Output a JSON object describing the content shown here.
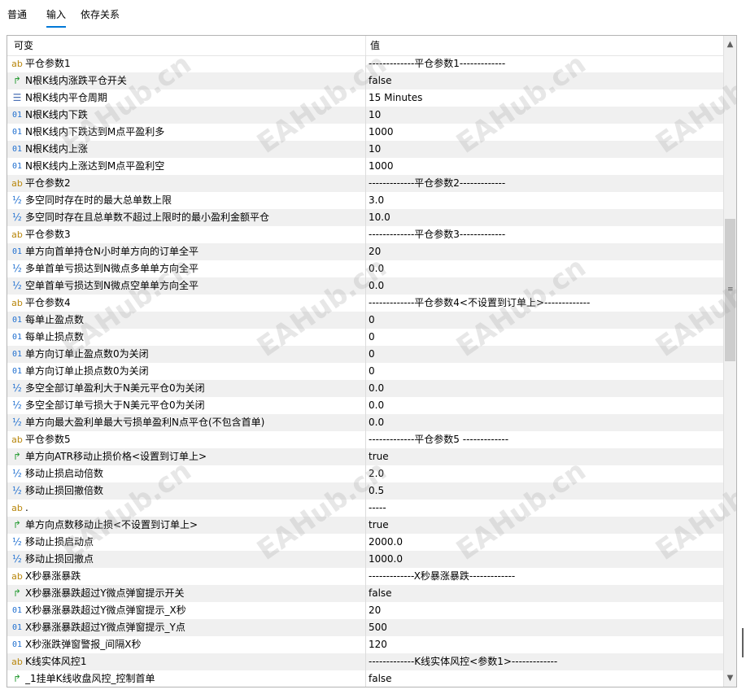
{
  "tabs": [
    {
      "label": "普通"
    },
    {
      "label": "输入"
    },
    {
      "label": "依存关系"
    }
  ],
  "active_tab": "输入",
  "table": {
    "header": {
      "name": "可变",
      "value": "值"
    },
    "rows": [
      {
        "icon": "ab",
        "name": "平仓参数1",
        "value": "-------------平仓参数1-------------"
      },
      {
        "icon": "bool",
        "name": "N根K线内涨跌平仓开关",
        "value": "false"
      },
      {
        "icon": "enum",
        "name": "N根K线内平仓周期",
        "value": "15 Minutes"
      },
      {
        "icon": "01",
        "name": "N根K线内下跌",
        "value": "10"
      },
      {
        "icon": "01",
        "name": "N根K线内下跌达到M点平盈利多",
        "value": "1000"
      },
      {
        "icon": "01",
        "name": "N根K线内上涨",
        "value": "10"
      },
      {
        "icon": "01",
        "name": "N根K线内上涨达到M点平盈利空",
        "value": "1000"
      },
      {
        "icon": "ab",
        "name": "平仓参数2",
        "value": "-------------平仓参数2-------------"
      },
      {
        "icon": "half",
        "name": "多空同时存在时的最大总单数上限",
        "value": "3.0"
      },
      {
        "icon": "half",
        "name": "多空同时存在且总单数不超过上限时的最小盈利金额平仓",
        "value": "10.0"
      },
      {
        "icon": "ab",
        "name": "平仓参数3",
        "value": "-------------平仓参数3-------------"
      },
      {
        "icon": "01",
        "name": "单方向首单持仓N小时单方向的订单全平",
        "value": "20"
      },
      {
        "icon": "half",
        "name": "多单首单亏损达到N微点多单单方向全平",
        "value": "0.0"
      },
      {
        "icon": "half",
        "name": "空单首单亏损达到N微点空单单方向全平",
        "value": "0.0"
      },
      {
        "icon": "ab",
        "name": "平仓参数4",
        "value": "-------------平仓参数4<不设置到订单上>-------------"
      },
      {
        "icon": "01",
        "name": "每单止盈点数",
        "value": "0"
      },
      {
        "icon": "01",
        "name": "每单止损点数",
        "value": "0"
      },
      {
        "icon": "01",
        "name": "单方向订单止盈点数0为关闭",
        "value": "0"
      },
      {
        "icon": "01",
        "name": "单方向订单止损点数0为关闭",
        "value": "0"
      },
      {
        "icon": "half",
        "name": "多空全部订单盈利大于N美元平仓0为关闭",
        "value": "0.0"
      },
      {
        "icon": "half",
        "name": "多空全部订单亏损大于N美元平仓0为关闭",
        "value": "0.0"
      },
      {
        "icon": "half",
        "name": "单方向最大盈利单最大亏损单盈利N点平仓(不包含首单)",
        "value": "0.0"
      },
      {
        "icon": "ab",
        "name": "平仓参数5",
        "value": "-------------平仓参数5 -------------"
      },
      {
        "icon": "bool",
        "name": "单方向ATR移动止损价格<设置到订单上>",
        "value": "true"
      },
      {
        "icon": "half",
        "name": "移动止损启动倍数",
        "value": "2.0"
      },
      {
        "icon": "half",
        "name": "移动止损回撤倍数",
        "value": "0.5"
      },
      {
        "icon": "ab",
        "name": ".",
        "value": "-----"
      },
      {
        "icon": "bool",
        "name": "单方向点数移动止损<不设置到订单上>",
        "value": "true"
      },
      {
        "icon": "half",
        "name": "移动止损启动点",
        "value": "2000.0"
      },
      {
        "icon": "half",
        "name": "移动止损回撤点",
        "value": "1000.0"
      },
      {
        "icon": "ab",
        "name": "X秒暴涨暴跌",
        "value": "-------------X秒暴涨暴跌-------------"
      },
      {
        "icon": "bool",
        "name": "X秒暴涨暴跌超过Y微点弹窗提示开关",
        "value": "false"
      },
      {
        "icon": "01",
        "name": "X秒暴涨暴跌超过Y微点弹窗提示_X秒",
        "value": "20"
      },
      {
        "icon": "01",
        "name": "X秒暴涨暴跌超过Y微点弹窗提示_Y点",
        "value": "500"
      },
      {
        "icon": "01",
        "name": "X秒涨跌弹窗警报_间隔X秒",
        "value": "120"
      },
      {
        "icon": "ab",
        "name": "K线实体风控1",
        "value": "-------------K线实体风控<参数1>-------------"
      },
      {
        "icon": "bool",
        "name": "_1挂单K线收盘风控_控制首单",
        "value": "false"
      }
    ]
  },
  "icon_glyphs": {
    "ab": "ab",
    "01": "01",
    "half": "½",
    "bool": "↱",
    "enum": "☰"
  },
  "scrollbar": {
    "up": "▲",
    "down": "▼",
    "grip": "≡"
  },
  "watermark": "EAHub.cn"
}
